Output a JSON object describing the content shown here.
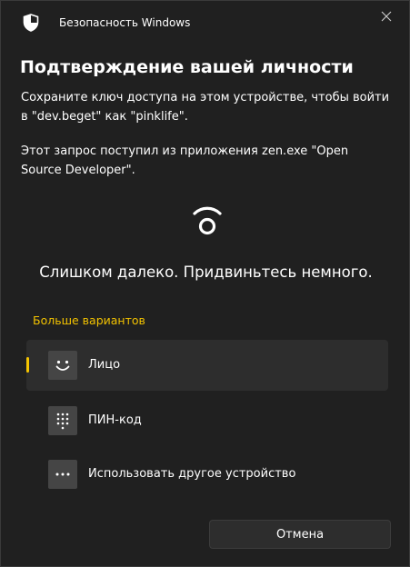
{
  "app": {
    "title": "Безопасность Windows",
    "icon": "shield-icon"
  },
  "dialog": {
    "heading": "Подтверждение вашей личности",
    "description_1": "Сохраните ключ доступа на этом устройстве, чтобы войти в \"dev.beget\" как \"pinklife\".",
    "description_2": "Этот запрос поступил из приложения zen.exe \"Open Source Developer\".",
    "status_icon": "face-recognition-icon",
    "status_text": "Слишком далеко. Придвиньтесь немного.",
    "more_options_label": "Больше вариантов",
    "options": [
      {
        "label": "Лицо",
        "icon": "face-icon",
        "selected": true
      },
      {
        "label": "ПИН-код",
        "icon": "keypad-icon",
        "selected": false
      },
      {
        "label": "Использовать другое устройство",
        "icon": "more-icon",
        "selected": false
      }
    ],
    "cancel_label": "Отмена"
  },
  "colors": {
    "background": "#202020",
    "selected_background": "#2d2d2d",
    "accent": "#f2c200",
    "icon_box": "#454545"
  }
}
